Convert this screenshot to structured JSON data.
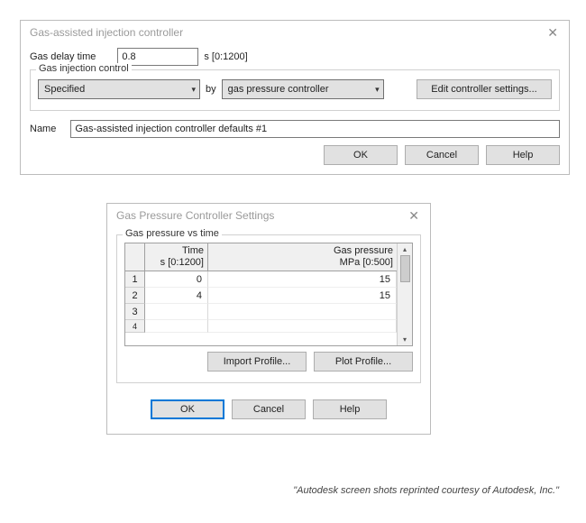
{
  "dialog1": {
    "title": "Gas-assisted injection controller",
    "delay_label": "Gas delay time",
    "delay_value": "0.8",
    "delay_unit": "s [0:1200]",
    "group_title": "Gas injection control",
    "method_value": "Specified",
    "by_label": "by",
    "by_value": "gas pressure controller",
    "edit_btn": "Edit controller settings...",
    "name_label": "Name",
    "name_value": "Gas-assisted injection controller defaults #1",
    "ok": "OK",
    "cancel": "Cancel",
    "help": "Help"
  },
  "dialog2": {
    "title": "Gas Pressure Controller Settings",
    "group_title": "Gas pressure vs time",
    "col_time_head1": "Time",
    "col_time_head2": "s [0:1200]",
    "col_press_head1": "Gas pressure",
    "col_press_head2": "MPa [0:500]",
    "rows": [
      {
        "n": "1",
        "time": "0",
        "press": "15"
      },
      {
        "n": "2",
        "time": "4",
        "press": "15"
      },
      {
        "n": "3",
        "time": "",
        "press": ""
      },
      {
        "n": "4",
        "time": "",
        "press": ""
      }
    ],
    "import_btn": "Import Profile...",
    "plot_btn": "Plot Profile...",
    "ok": "OK",
    "cancel": "Cancel",
    "help": "Help"
  },
  "credit": "\"Autodesk screen shots reprinted courtesy of Autodesk, Inc.\""
}
